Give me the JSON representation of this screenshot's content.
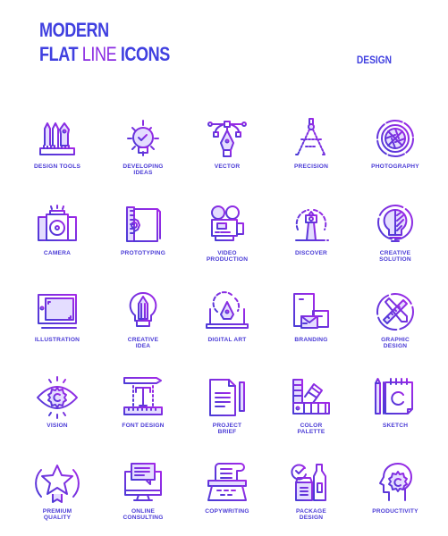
{
  "header": {
    "line1": "MODERN",
    "line2_bold1": "FLAT",
    "line2_light": "LINE",
    "line2_bold2": "ICONS",
    "category": "DESIGN"
  },
  "colors": {
    "primary": "#4040e0",
    "accent": "#8a2be2",
    "fill": "#e2dcff"
  },
  "icons": [
    {
      "icon": "design-tools-icon",
      "label": "DESIGN TOOLS"
    },
    {
      "icon": "developing-ideas-icon",
      "label": "DEVELOPING\nIDEAS"
    },
    {
      "icon": "vector-icon",
      "label": "VECTOR"
    },
    {
      "icon": "precision-icon",
      "label": "PRECISION"
    },
    {
      "icon": "photography-icon",
      "label": "PHOTOGRAPHY"
    },
    {
      "icon": "camera-icon",
      "label": "CAMERA"
    },
    {
      "icon": "prototyping-icon",
      "label": "PROTOTYPING"
    },
    {
      "icon": "video-production-icon",
      "label": "VIDEO\nPRODUCTION"
    },
    {
      "icon": "discover-icon",
      "label": "DISCOVER"
    },
    {
      "icon": "creative-solution-icon",
      "label": "CREATIVE\nSOLUTION"
    },
    {
      "icon": "illustration-icon",
      "label": "ILLUSTRATION"
    },
    {
      "icon": "creative-idea-icon",
      "label": "CREATIVE\nIDEA"
    },
    {
      "icon": "digital-art-icon",
      "label": "DIGITAL ART"
    },
    {
      "icon": "branding-icon",
      "label": "BRANDING"
    },
    {
      "icon": "graphic-design-icon",
      "label": "GRAPHIC\nDESIGN"
    },
    {
      "icon": "vision-icon",
      "label": "VISION"
    },
    {
      "icon": "font-design-icon",
      "label": "FONT DESIGN"
    },
    {
      "icon": "project-brief-icon",
      "label": "PROJECT\nBRIEF"
    },
    {
      "icon": "color-palette-icon",
      "label": "COLOR\nPALETTE"
    },
    {
      "icon": "sketch-icon",
      "label": "SKETCH"
    },
    {
      "icon": "premium-quality-icon",
      "label": "PREMIUM\nQUALITY"
    },
    {
      "icon": "online-consulting-icon",
      "label": "ONLINE\nCONSULTING"
    },
    {
      "icon": "copywriting-icon",
      "label": "COPYWRITING"
    },
    {
      "icon": "package-design-icon",
      "label": "PACKAGE\nDESIGN"
    },
    {
      "icon": "productivity-icon",
      "label": "PRODUCTIVITY"
    }
  ]
}
